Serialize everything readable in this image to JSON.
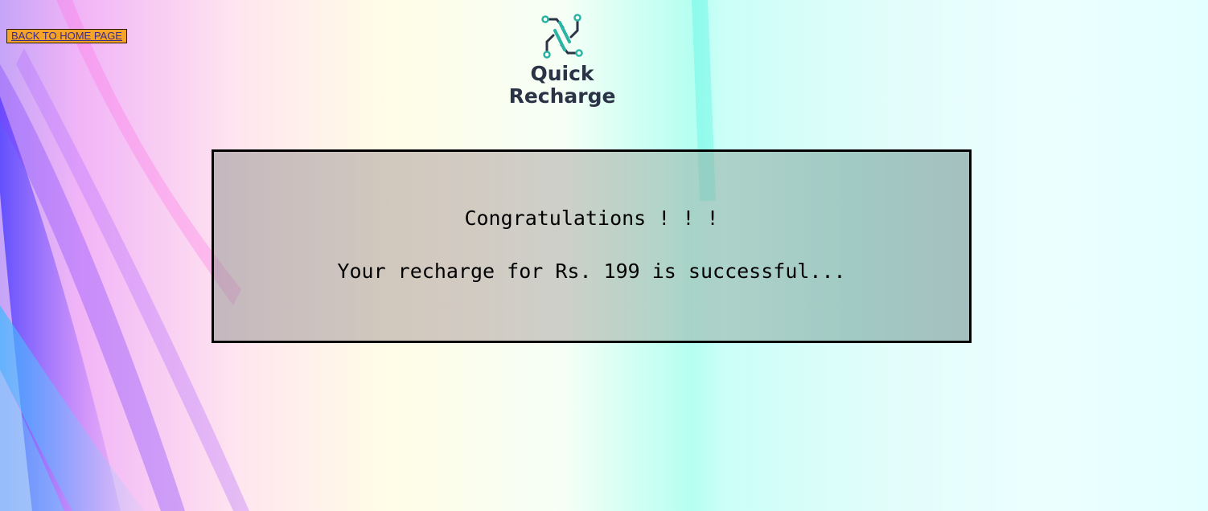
{
  "nav": {
    "back_label": "BACK TO HOME PAGE"
  },
  "logo": {
    "line1": "Quick",
    "line2": "Recharge",
    "mark_color": "#2bb3a3",
    "text_color": "#2b3346"
  },
  "result": {
    "heading": "Congratulations ! ! !",
    "message": "Your recharge for Rs. 199 is successful..."
  },
  "colors": {
    "back_button_bg": "#f4a328",
    "box_border": "#000000"
  }
}
